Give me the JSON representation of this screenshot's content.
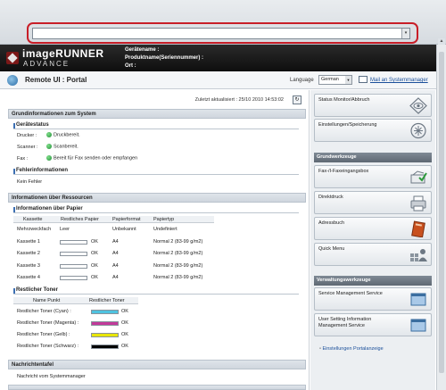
{
  "browser": {
    "address_value": "",
    "dropdown_glyph": "▾"
  },
  "device_header": {
    "brand_line1": "imageRUNNER",
    "brand_line2": "ADVANCE",
    "device_name_label": "Gerätename :",
    "product_name_label": "Produktname(Seriennummer) :",
    "location_label": "Ort :"
  },
  "portal": {
    "title": "Remote UI : Portal",
    "language_label": "Language",
    "language_value": "German",
    "mail_link": "Mail an Systemmanager"
  },
  "main": {
    "last_updated": "Zuletzt aktualisiert : 25/10 2010 14:53:02",
    "system_section": "Grundinformationen zum System",
    "device_status_sub": "Gerätestatus",
    "device_status": [
      {
        "label": "Drucker :",
        "value": "Druckbereit."
      },
      {
        "label": "Scanner :",
        "value": "Scanbereit."
      },
      {
        "label": "Fax :",
        "value": "Bereit für Fax senden oder empfangen"
      }
    ],
    "error_sub": "Fehlerinformationen",
    "error_text": "Kein Fehler",
    "resources_section": "Informationen über Ressourcen",
    "paper_sub": "Informationen über Papier",
    "paper_headers": [
      "Kassette",
      "Restliches Papier",
      "Papierformat",
      "Papiertyp"
    ],
    "paper_rows": [
      {
        "cassette": "Mehrzweckfach",
        "remaining": "Leer",
        "fill": null,
        "format": "Unbekannt",
        "type": "Undefiniert"
      },
      {
        "cassette": "Kassette 1",
        "remaining": "OK",
        "fill": 0,
        "format": "A4",
        "type": "Normal 2 (83-99 g/m2)"
      },
      {
        "cassette": "Kassette 2",
        "remaining": "OK",
        "fill": 0,
        "format": "A4",
        "type": "Normal 2 (83-99 g/m2)"
      },
      {
        "cassette": "Kassette 3",
        "remaining": "OK",
        "fill": 0,
        "format": "A4",
        "type": "Normal 2 (83-99 g/m2)"
      },
      {
        "cassette": "Kassette 4",
        "remaining": "OK",
        "fill": 0,
        "format": "A4",
        "type": "Normal 2 (83-99 g/m2)"
      }
    ],
    "toner_sub": "Restlicher Toner",
    "toner_headers": [
      "Name Punkt",
      "Restlicher Toner"
    ],
    "toner_rows": [
      {
        "name": "Restlicher Toner (Cyan) :",
        "status": "OK",
        "color": "#4fc3e0"
      },
      {
        "name": "Restlicher Toner (Magenta) :",
        "status": "OK",
        "color": "#c23a9a"
      },
      {
        "name": "Restlicher Toner (Gelb) :",
        "status": "OK",
        "color": "#e8e600"
      },
      {
        "name": "Restlicher Toner (Schwarz) :",
        "status": "OK",
        "color": "#000000"
      }
    ],
    "news_section": "Nachrichtentafel",
    "news_text": "Nachricht vom Systemmanager"
  },
  "side": {
    "status_monitor": "Status Monitor/Abbruch",
    "settings": "Einstellungen/Speicherung",
    "basic_tools_header": "Grundwerkzeuge",
    "fax_inbox": "Fax-/I-Faxeingangsbox",
    "direct_print": "Direktdruck",
    "address_book": "Adressbuch",
    "quick_menu": "Quick Menu",
    "admin_tools_header": "Verwaltungswerkzeuge",
    "service_mgmt": "Service Management Service",
    "user_setting_line1": "User Setting Information",
    "user_setting_line2": "Management Service",
    "portal_link": "Einstellungen Portalanzeige"
  }
}
